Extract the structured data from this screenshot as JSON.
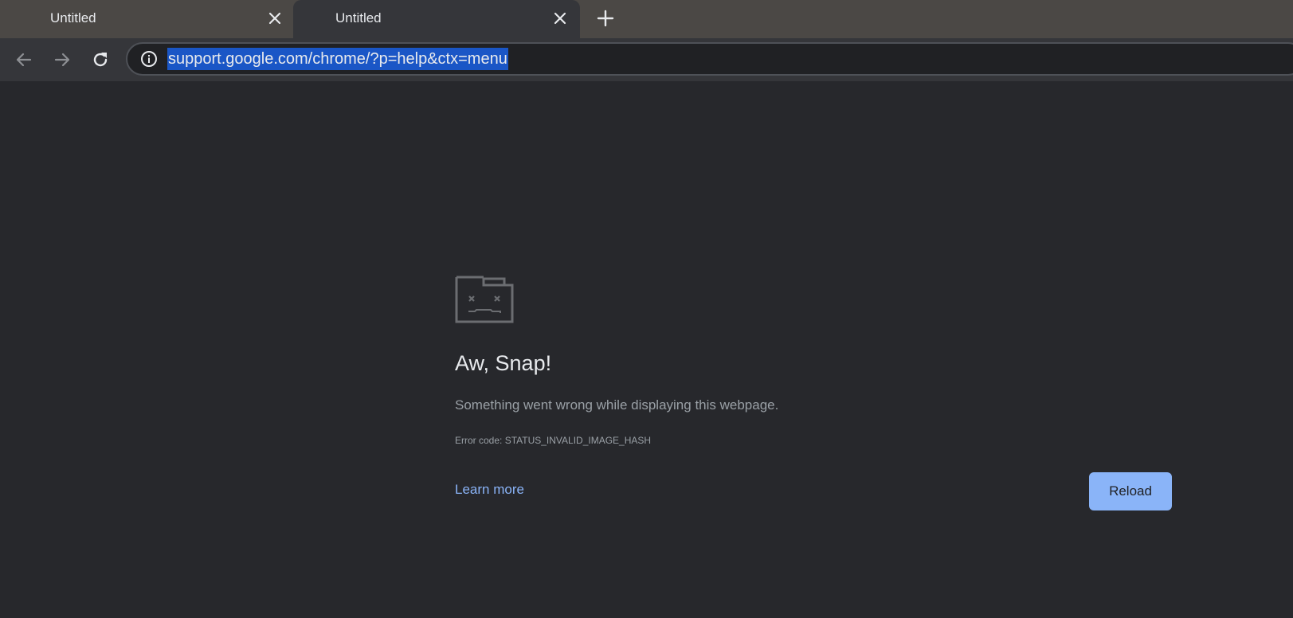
{
  "tabs": [
    {
      "title": "Untitled",
      "active": false
    },
    {
      "title": "Untitled",
      "active": true
    }
  ],
  "toolbar": {
    "url": "support.google.com/chrome/?p=help&ctx=menu"
  },
  "error": {
    "title": "Aw, Snap!",
    "message": "Something went wrong while displaying this webpage.",
    "code": "Error code: STATUS_INVALID_IMAGE_HASH",
    "learn_more": "Learn more",
    "reload": "Reload"
  },
  "colors": {
    "accent": "#8ab4f8",
    "url_selection": "#1a56c6",
    "page_background": "#27282c"
  },
  "icons": [
    "close-icon",
    "new-tab-icon",
    "back-icon",
    "forward-icon",
    "reload-icon",
    "info-icon",
    "sad-tab-icon"
  ]
}
